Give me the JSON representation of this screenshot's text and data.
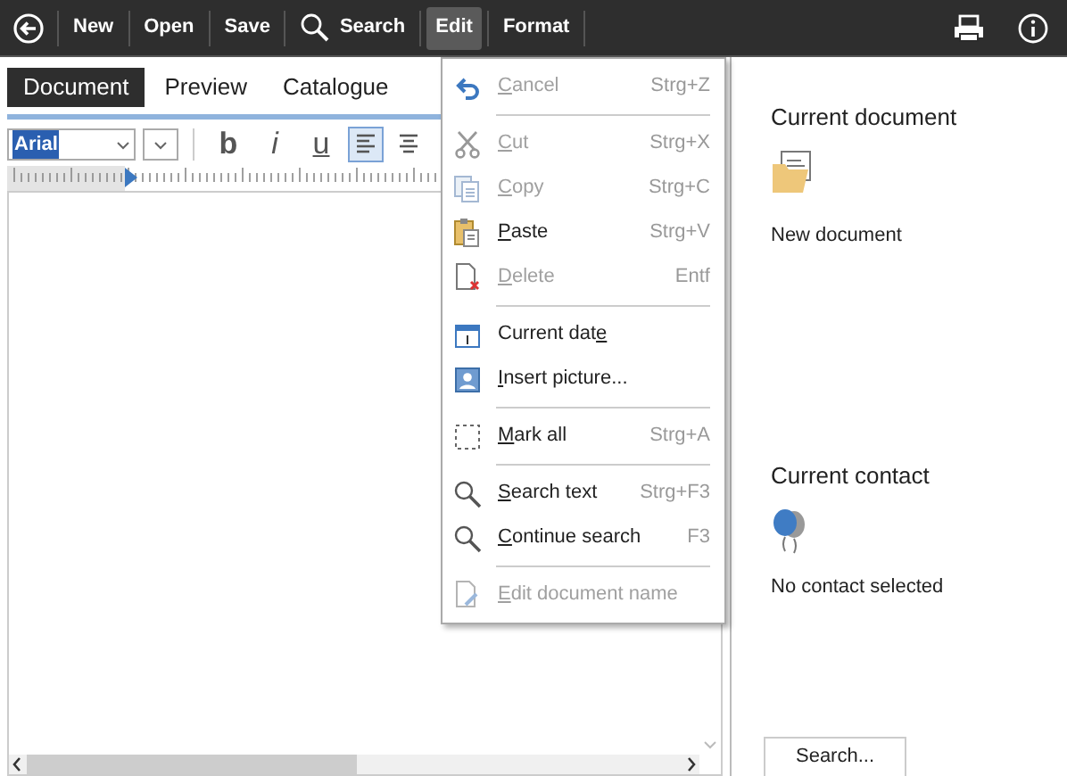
{
  "toolbar": {
    "buttons": [
      {
        "kind": "back"
      },
      {
        "kind": "text",
        "label": "New",
        "selected": false
      },
      {
        "kind": "text",
        "label": "Open",
        "selected": false
      },
      {
        "kind": "text",
        "label": "Save",
        "selected": false
      },
      {
        "kind": "search",
        "label": "Search",
        "selected": false
      },
      {
        "kind": "text",
        "label": "Edit",
        "selected": true
      },
      {
        "kind": "text",
        "label": "Format",
        "selected": false
      }
    ],
    "right": [
      {
        "kind": "print"
      },
      {
        "kind": "info"
      }
    ]
  },
  "tabs": [
    {
      "label": "Document",
      "selected": true
    },
    {
      "label": "Preview",
      "selected": false
    },
    {
      "label": "Catalogue",
      "selected": false
    }
  ],
  "format_bar": {
    "font": {
      "value": "Arial",
      "selected": true
    },
    "styles": [
      {
        "kind": "bold",
        "label": "b"
      },
      {
        "kind": "italic",
        "label": "i"
      },
      {
        "kind": "underline",
        "label": "u"
      }
    ],
    "align": [
      {
        "kind": "left",
        "selected": true
      },
      {
        "kind": "center",
        "selected": false
      }
    ]
  },
  "edit_menu": [
    {
      "kind": "item",
      "label": {
        "key": "C",
        "after": "ancel"
      },
      "shortcut": "Strg+Z",
      "disabled": true
    },
    {
      "kind": "separator"
    },
    {
      "kind": "item",
      "label": {
        "key": "C",
        "after": "ut"
      },
      "shortcut": "Strg+X",
      "disabled": true
    },
    {
      "kind": "item",
      "label": {
        "key": "C",
        "after": "opy"
      },
      "shortcut": "Strg+C",
      "disabled": true
    },
    {
      "kind": "item",
      "label": {
        "key": "P",
        "after": "aste"
      },
      "shortcut": "Strg+V",
      "disabled": false
    },
    {
      "kind": "item",
      "label": {
        "key": "D",
        "after": "elete"
      },
      "shortcut": "Entf",
      "disabled": true
    },
    {
      "kind": "separator"
    },
    {
      "kind": "item",
      "label": {
        "before": "Current dat",
        "key": "e"
      },
      "disabled": false
    },
    {
      "kind": "item",
      "label": {
        "key": "I",
        "after": "nsert picture..."
      },
      "disabled": false
    },
    {
      "kind": "separator"
    },
    {
      "kind": "item",
      "label": {
        "key": "M",
        "after": "ark all"
      },
      "shortcut": "Strg+A",
      "disabled": false
    },
    {
      "kind": "separator"
    },
    {
      "kind": "item",
      "label": {
        "key": "S",
        "after": "earch text"
      },
      "shortcut": "Strg+F3",
      "disabled": false
    },
    {
      "kind": "item",
      "label": {
        "key": "C",
        "after": "ontinue search"
      },
      "shortcut": "F3",
      "disabled": false
    },
    {
      "kind": "separator"
    },
    {
      "kind": "item",
      "label": {
        "key": "E",
        "after": "dit document name"
      },
      "disabled": true
    }
  ],
  "side_panel": {
    "document": {
      "title": "Current document",
      "name": "New document"
    },
    "contact": {
      "title": "Current contact",
      "name": "No contact selected"
    },
    "search_button": "Search..."
  }
}
